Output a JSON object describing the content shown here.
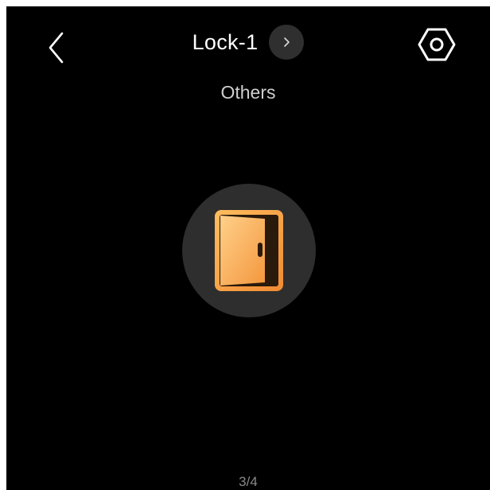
{
  "header": {
    "title": "Lock-1",
    "back_icon": "chevron-left-icon",
    "title_arrow_icon": "chevron-right-icon",
    "settings_icon": "hex-settings-icon"
  },
  "main": {
    "subtitle": "Others",
    "device_icon": "door-icon",
    "accent_color": "#f39436"
  },
  "footer": {
    "page_indicator": "3/4"
  }
}
